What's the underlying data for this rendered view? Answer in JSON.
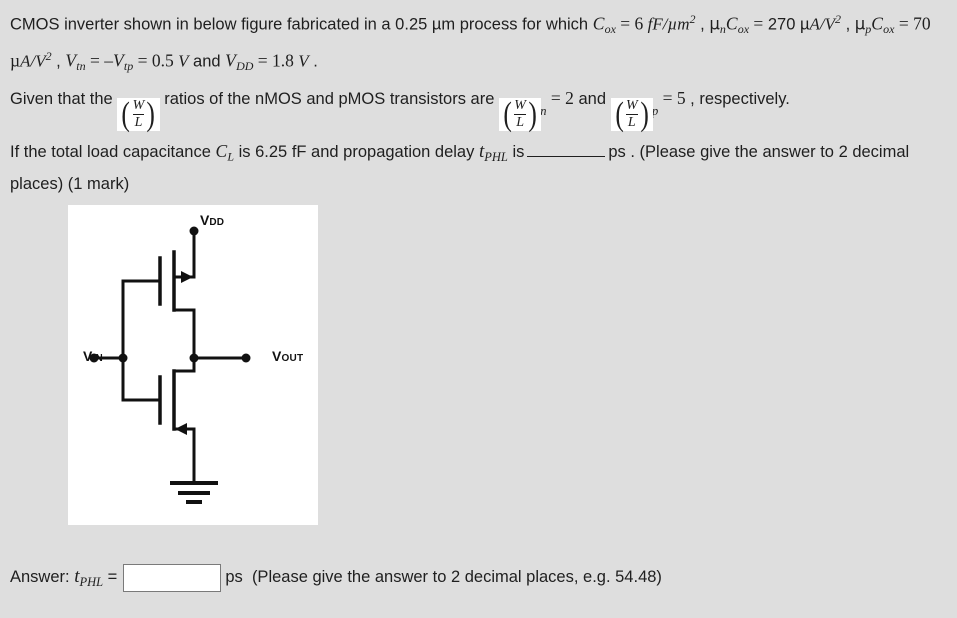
{
  "question": {
    "line1": {
      "t1": "CMOS inverter shown in below figure fabricated in a 0.25 µm process for which ",
      "cox_sym": "C",
      "cox_sub": "ox",
      "eq1": " = 6 ",
      "cox_val_unit": "fF/µm",
      "cox_unit_sup": "2",
      "t2": " , ",
      "mu_n": "µ",
      "mu_n_sub": "n",
      "mu_n_c": "C",
      "mu_n_c_sub": "ox",
      "eq2": " ="
    },
    "line2": {
      "val1": "270 µ",
      "val1_unit_a": "A/V",
      "val1_sup": "2",
      "sep1": " , ",
      "mu_p": "µ",
      "mu_p_sub": "p",
      "mu_p_c": "C",
      "mu_p_c_sub": "ox",
      "eq3": " = 70 µ",
      "val2_unit_a": "A/V",
      "val2_sup": "2",
      "sep2": " , ",
      "vtn": "V",
      "vtn_sub": "tn",
      "eq4": " = –",
      "vtp": "V",
      "vtp_sub": "tp",
      "eq5": " = 0.5 ",
      "v_unit1": "V",
      "and_txt": " and ",
      "vdd": "V",
      "vdd_sub": "DD",
      "eq6": " = 1.8 ",
      "v_unit2": "V",
      "period": " ."
    },
    "line3": {
      "t1": "Given that the ",
      "frac_num": "W",
      "frac_den": "L",
      "t2": " ratios of the nMOS and pMOS transistors are ",
      "sub_n": "n",
      "eq_n": " = 2",
      "and_txt": " and ",
      "sub_p": "p",
      "eq_p": " = 5",
      "t3": " , respectively."
    },
    "line4": {
      "t1": "If the total load capacitance ",
      "cl": "C",
      "cl_sub": "L",
      "t2": " is 6.25 fF and propagation delay ",
      "tphl": "t",
      "tphl_sub": "PHL",
      "t3": " is",
      "blank": "",
      "t4": "ps . (Please give the"
    },
    "line5": "answer to 2 decimal places) (1 mark)"
  },
  "figure": {
    "title": "cmos-inverter-schematic",
    "vdd_label": "V",
    "vdd_sub": "DD",
    "vin_label": "V",
    "vin_sub": "IN",
    "vout_label": "V",
    "vout_sub": "OUT",
    "background": "#ffffff",
    "line_color": "#111111"
  },
  "answer": {
    "label": "Answer: ",
    "symbol": "t",
    "symbol_sub": "PHL",
    "equals": " =",
    "value": "",
    "placeholder": "",
    "unit": "ps",
    "hint": "(Please give the answer to 2 decimal places, e.g. 54.48)"
  },
  "colors": {
    "page_background": "#dedede",
    "text": "#1f1f1f",
    "figure_background": "#ffffff",
    "input_border": "#7a7a7a"
  }
}
